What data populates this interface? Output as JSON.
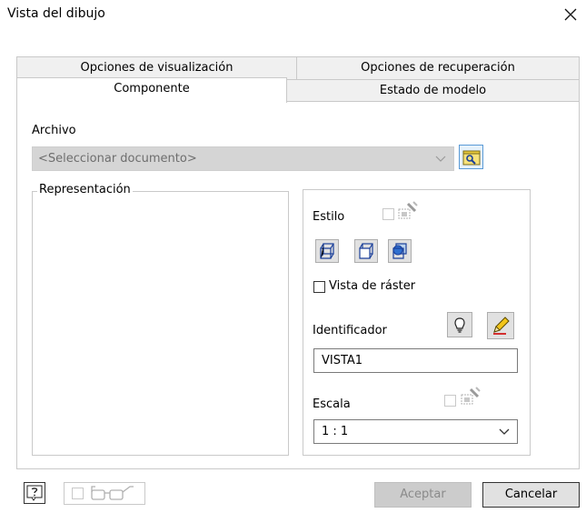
{
  "window": {
    "title": "Vista del dibujo"
  },
  "tabs": {
    "row1": [
      "Opciones de visualización",
      "Opciones de recuperación"
    ],
    "row2": [
      "Componente",
      "Estado de modelo"
    ],
    "active": "Componente"
  },
  "archivo": {
    "label": "Archivo",
    "value": "<Seleccionar documento>"
  },
  "representacion": {
    "label": "Representación"
  },
  "estilo": {
    "label": "Estilo"
  },
  "raster": {
    "label": "Vista de ráster",
    "checked": false
  },
  "identificador": {
    "label": "Identificador",
    "value": "VISTA1"
  },
  "escala": {
    "label": "Escala",
    "value": "1 : 1"
  },
  "footer": {
    "ok_label": "Aceptar",
    "cancel_label": "Cancelar"
  },
  "icons": [
    "close-icon",
    "chevron-down-icon",
    "browse-folder-icon",
    "style-from-base-icon",
    "hidden-line-icon",
    "hidden-line-removed-icon",
    "shaded-icon",
    "lightbulb-icon",
    "pencil-icon",
    "help-icon",
    "glasses-icon"
  ],
  "colors": {
    "accent": "#5a9ad6",
    "disabled_bg": "#d5d5d5",
    "border": "#c9c9c9"
  }
}
